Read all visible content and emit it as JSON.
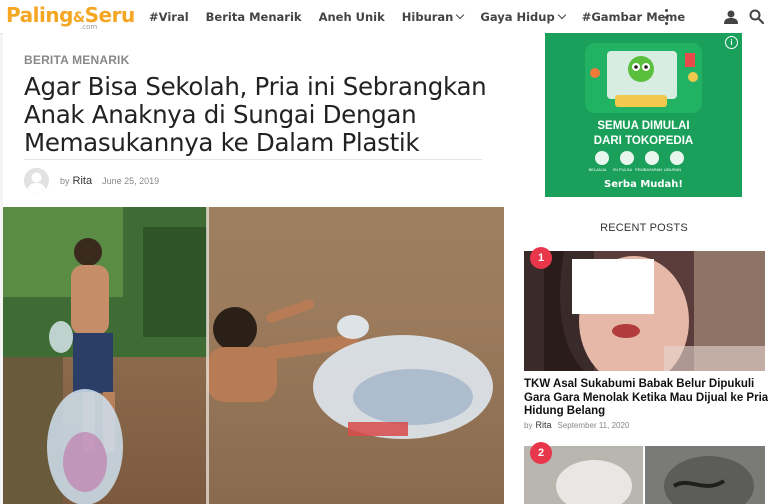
{
  "header": {
    "logo_main": "Paling",
    "logo_amp": "&",
    "logo_end": "Seru",
    "logo_sub": ".com",
    "nav": [
      {
        "label": "#Viral",
        "dropdown": false
      },
      {
        "label": "Berita Menarik",
        "dropdown": false
      },
      {
        "label": "Aneh Unik",
        "dropdown": false
      },
      {
        "label": "Hiburan",
        "dropdown": true
      },
      {
        "label": "Gaya Hidup",
        "dropdown": true
      },
      {
        "label": "#Gambar Meme",
        "dropdown": false
      }
    ]
  },
  "article": {
    "category": "BERITA MENARIK",
    "title": "Agar Bisa Sekolah, Pria ini Sebrangkan Anak Anaknya di Sungai Dengan Memasukannya ke Dalam Plastik",
    "by": "by",
    "author": "Rita",
    "date": "June 25, 2019"
  },
  "sidebar": {
    "ad": {
      "line1": "SEMUA DIMULAI",
      "line2": "DARI TOKOPEDIA",
      "line3": "Serba Mudah!",
      "captions": [
        "BELANJA",
        "ISI PULSA",
        "PEMBAYARAN",
        "LIBURAN"
      ],
      "info": "i"
    },
    "recent_title": "RECENT POSTS",
    "posts": [
      {
        "rank": "1",
        "title": "TKW Asal Sukabumi Babak Belur Dipukuli Gara Gara Menolak Ketika Mau Dijual ke Pria Hidung Belang",
        "by": "by",
        "author": "Rita",
        "date": "September 11, 2020"
      },
      {
        "rank": "2"
      }
    ]
  },
  "colors": {
    "accent": "#f5a623",
    "badge": "#e8374a",
    "ad_green": "#1aa05a"
  }
}
